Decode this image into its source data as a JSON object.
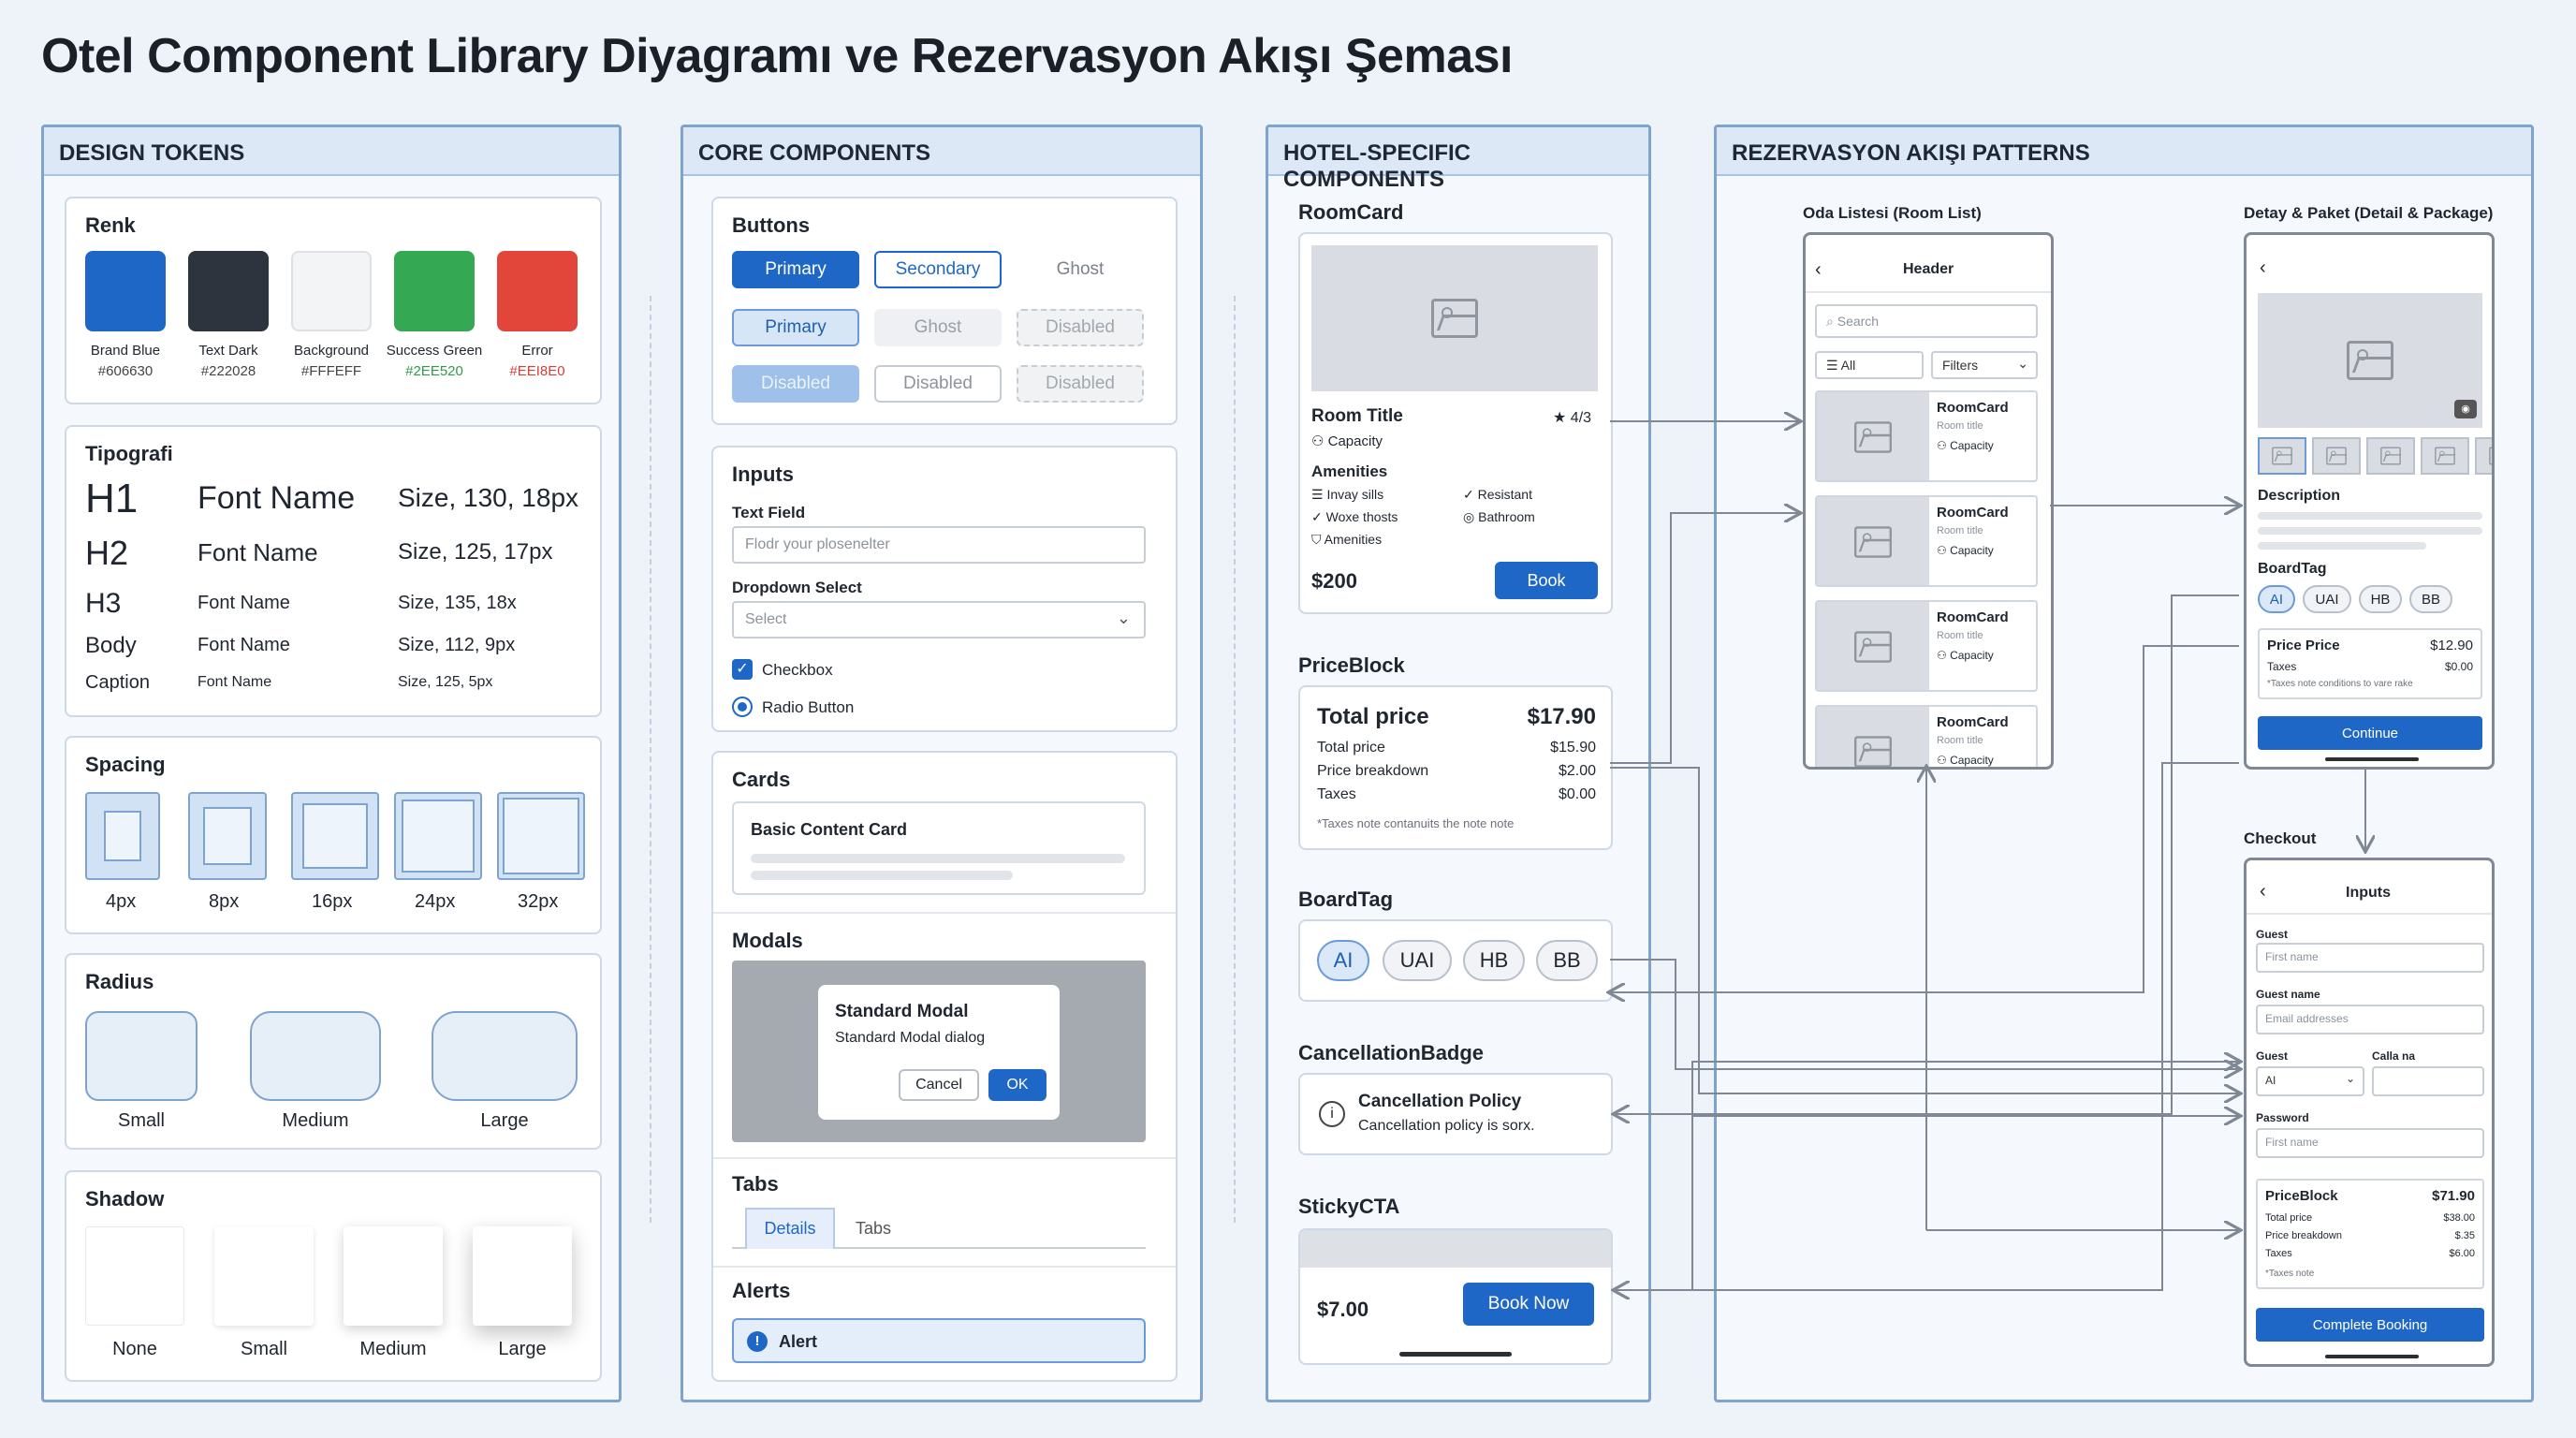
{
  "title": "Otel Component Library Diyagramı ve Rezervasyon Akışı Şeması",
  "colors": {
    "accent": "#1f67c6",
    "panel_border": "#7ea3cf",
    "panel_head": "#dce8f6"
  },
  "panels": {
    "tokens": "DESIGN TOKENS",
    "core": "CORE COMPONENTS",
    "hotel": "HOTEL-SPECIFIC COMPONENTS",
    "flow": "REZERVASYON AKIŞI PATTERNS"
  },
  "renk": {
    "title": "Renk",
    "swatches": [
      {
        "name": "Brand Blue",
        "hex": "#606630",
        "color": "#1f67c6"
      },
      {
        "name": "Text Dark",
        "hex": "#222028",
        "color": "#2e343d"
      },
      {
        "name": "Background",
        "hex": "#FFFEFF",
        "color": "#f3f4f6"
      },
      {
        "name": "Success Green",
        "hex": "#2EE520",
        "color": "#34a853"
      },
      {
        "name": "Error",
        "hex": "#EEI8E0",
        "color": "#e2463a"
      }
    ]
  },
  "tipografi": {
    "title": "Tipografi",
    "rows": [
      {
        "level": "H1",
        "font": "Font Name",
        "size": "Size, 130, 18px"
      },
      {
        "level": "H2",
        "font": "Font Name",
        "size": "Size, 125, 17px"
      },
      {
        "level": "H3",
        "font": "Font Name",
        "size": "Size, 135, 18x"
      },
      {
        "level": "Body",
        "font": "Font Name",
        "size": "Size, 112, 9px"
      },
      {
        "level": "Caption",
        "font": "Font Name",
        "size": "Size, 125, 5px"
      }
    ]
  },
  "spacing": {
    "title": "Spacing",
    "items": [
      "4px",
      "8px",
      "16px",
      "24px",
      "32px"
    ]
  },
  "radius": {
    "title": "Radius",
    "items": [
      "Small",
      "Medium",
      "Large"
    ]
  },
  "shadow": {
    "title": "Shadow",
    "items": [
      "None",
      "Small",
      "Medium",
      "Large"
    ]
  },
  "buttons": {
    "title": "Buttons",
    "row1": [
      "Primary",
      "Secondary",
      "Ghost"
    ],
    "row2": [
      "Primary",
      "Ghost",
      "Disabled"
    ],
    "row3": [
      "Disabled",
      "Disabled",
      "Disabled"
    ]
  },
  "inputs": {
    "title": "Inputs",
    "text_label": "Text Field",
    "text_placeholder": "Flodr your plosenelter",
    "dropdown_label": "Dropdown Select",
    "dropdown_value": "Select",
    "checkbox": "Checkbox",
    "radio": "Radio Button"
  },
  "cards": {
    "title": "Cards",
    "card_title": "Basic Content Card"
  },
  "modals": {
    "title": "Modals",
    "modal_title": "Standard Modal",
    "modal_text": "Standard Modal dialog",
    "cancel": "Cancel",
    "ok": "OK"
  },
  "tabs": {
    "title": "Tabs",
    "items": [
      "Details",
      "Tabs"
    ]
  },
  "alerts": {
    "title": "Alerts",
    "text": "Alert"
  },
  "roomcard": {
    "title": "RoomCard",
    "room_title": "Room Title",
    "rating": "★ 4/3",
    "capacity": "Capacity",
    "amenities_title": "Amenities",
    "amenities": [
      "Invay sills",
      "Resistant",
      "Woxe thosts",
      "Bathroom",
      "Amenities"
    ],
    "price": "$200",
    "book": "Book"
  },
  "priceblock": {
    "title": "PriceBlock",
    "total_label": "Total price",
    "total_value": "$17.90",
    "lines": [
      {
        "label": "Total price",
        "value": "$15.90"
      },
      {
        "label": "Price breakdown",
        "value": "$2.00"
      },
      {
        "label": "Taxes",
        "value": "$0.00"
      }
    ],
    "note": "*Taxes note contanuits the note note"
  },
  "boardtag": {
    "title": "BoardTag",
    "items": [
      "AI",
      "UAI",
      "HB",
      "BB"
    ]
  },
  "cancellation": {
    "title": "CancellationBadge",
    "policy": "Cancellation Policy",
    "text": "Cancellation policy is sorx."
  },
  "sticky": {
    "title": "StickyCTA",
    "price": "$7.00",
    "cta": "Book Now"
  },
  "roomlist": {
    "title": "Oda Listesi (Room List)",
    "header": "Header",
    "search": "Search",
    "all": "All",
    "filters": "Filters",
    "item_title": "RoomCard",
    "item_sub": "Room title",
    "item_cap": "Capacity"
  },
  "detail": {
    "title": "Detay & Paket (Detail & Package)",
    "description": "Description",
    "boardtag": "BoardTag",
    "tags": [
      "AI",
      "UAI",
      "HB",
      "BB"
    ],
    "price_label": "Price Price",
    "price_value": "$12.90",
    "taxes_label": "Taxes",
    "taxes_value": "$0.00",
    "note": "*Taxes note conditions to vare rake",
    "continue": "Continue"
  },
  "checkout": {
    "title": "Checkout",
    "header": "Inputs",
    "guest": "Guest",
    "first_name": "First name",
    "guest_name": "Guest name",
    "email": "Email addresses",
    "guest2": "Guest",
    "calla": "Calla na",
    "select_val": "AI",
    "password": "Password",
    "first_name2": "First name",
    "pb_title": "PriceBlock",
    "pb_total": "$71.90",
    "pb_lines": [
      {
        "label": "Total price",
        "value": "$38.00"
      },
      {
        "label": "Price breakdown",
        "value": "$.35"
      },
      {
        "label": "Taxes",
        "value": "$6.00"
      }
    ],
    "pb_note": "*Taxes note",
    "complete": "Complete Booking"
  }
}
